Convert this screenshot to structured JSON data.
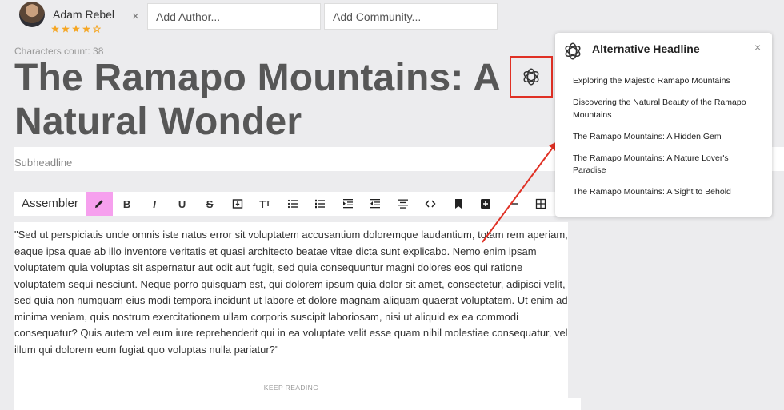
{
  "author": {
    "name": "Adam Rebel",
    "rating": 4,
    "max_rating": 5,
    "remove_label": "×"
  },
  "fields": {
    "add_author_placeholder": "Add Author...",
    "add_community_placeholder": "Add Community..."
  },
  "characters_count": "Characters count: 38",
  "headline": "The Ramapo Mountains: A Natural Wonder",
  "subheadline_placeholder": "Subheadline",
  "toolbar": {
    "assembler_label": "Assembler",
    "buttons": [
      "pencil-icon",
      "bold-icon",
      "italic-icon",
      "underline-icon",
      "strikethrough-icon",
      "save-icon",
      "text-size-icon",
      "bullet-list-icon",
      "numbered-list-icon",
      "indent-icon",
      "outdent-icon",
      "align-center-icon",
      "code-icon",
      "bookmark-icon",
      "add-box-icon",
      "minus-icon",
      "table-icon"
    ],
    "active_button": "pencil-icon"
  },
  "body_text": "\"Sed ut perspiciatis unde omnis iste natus error sit voluptatem accusantium doloremque laudantium, totam rem aperiam, eaque ipsa quae ab illo inventore veritatis et quasi architecto beatae vitae dicta sunt explicabo. Nemo enim ipsam voluptatem quia voluptas sit aspernatur aut odit aut fugit, sed quia consequuntur magni dolores eos qui ratione voluptatem sequi nesciunt. Neque porro quisquam est, qui dolorem ipsum quia dolor sit amet, consectetur, adipisci velit, sed quia non numquam eius modi tempora incidunt ut labore et dolore magnam aliquam quaerat voluptatem. Ut enim ad minima veniam, quis nostrum exercitationem ullam corporis suscipit laboriosam, nisi ut aliquid ex ea commodi consequatur? Quis autem vel eum iure reprehenderit qui in ea voluptate velit esse quam nihil molestiae consequatur, vel illum qui dolorem eum fugiat quo voluptas nulla pariatur?\"",
  "keep_reading": "KEEP READING",
  "popup": {
    "title": "Alternative Headline",
    "close_label": "×",
    "suggestions": [
      "Exploring the Majestic Ramapo Mountains",
      "Discovering the Natural Beauty of the Ramapo Mountains",
      "The Ramapo Mountains: A Hidden Gem",
      "The Ramapo Mountains: A Nature Lover's Paradise",
      "The Ramapo Mountains: A Sight to Behold"
    ]
  },
  "colors": {
    "highlight_box": "#e03024",
    "active_tool": "#f6a0ee",
    "star": "#f5a623",
    "arrow": "#e03024"
  }
}
